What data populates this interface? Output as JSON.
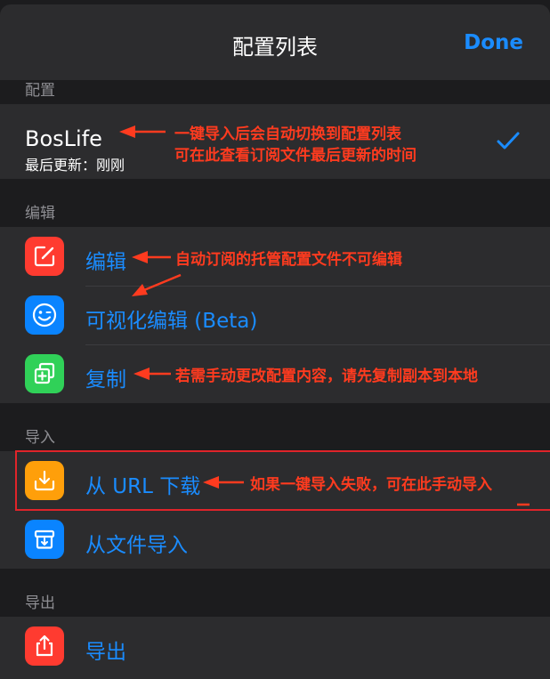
{
  "nav": {
    "title": "配置列表",
    "done_label": "Done"
  },
  "sections": {
    "config": {
      "header": "配置",
      "item": {
        "name": "BosLife",
        "subtitle": "最后更新：刚刚",
        "selected": true
      }
    },
    "edit": {
      "header": "编辑",
      "items": [
        {
          "label": "编辑",
          "icon": "edit-icon",
          "color": "#ff3b30"
        },
        {
          "label": "可视化编辑 (Beta)",
          "icon": "smiley-icon",
          "color": "#0a84ff"
        },
        {
          "label": "复制",
          "icon": "duplicate-icon",
          "color": "#30d158"
        }
      ]
    },
    "import": {
      "header": "导入",
      "items": [
        {
          "label": "从 URL 下载",
          "icon": "download-icon",
          "color": "#ff9f0a"
        },
        {
          "label": "从文件导入",
          "icon": "archive-import-icon",
          "color": "#0a84ff"
        }
      ]
    },
    "export": {
      "header": "导出",
      "items": [
        {
          "label": "导出",
          "icon": "share-icon",
          "color": "#ff3b30"
        }
      ]
    }
  },
  "annotations": {
    "config_line1": "一键导入后会自动切换到配置列表",
    "config_line2": "可在此查看订阅文件最后更新的时间",
    "edit": "自动订阅的托管配置文件不可编辑",
    "duplicate": "若需手动更改配置内容，请先复制副本到本地",
    "url": "如果一键导入失败，可在此手动导入"
  },
  "colors": {
    "accent": "#1a8cff",
    "annotation": "#ff3b1f",
    "highlight": "#e0242a"
  }
}
